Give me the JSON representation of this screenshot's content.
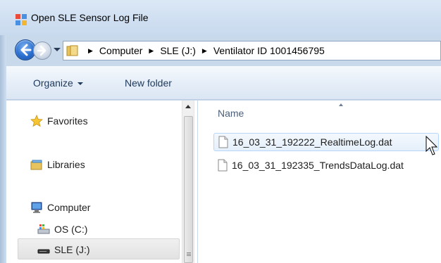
{
  "window": {
    "title": "Open SLE Sensor Log File"
  },
  "address_bar": {
    "crumbs": [
      "Computer",
      "SLE (J:)",
      "Ventilator ID 1001456795"
    ]
  },
  "toolbar": {
    "organize_label": "Organize",
    "new_folder_label": "New folder"
  },
  "navigation": {
    "items": [
      {
        "label": "Favorites",
        "icon": "star-icon"
      },
      {
        "label": "Libraries",
        "icon": "libraries-icon"
      },
      {
        "label": "Computer",
        "icon": "computer-icon"
      },
      {
        "label": "OS (C:)",
        "icon": "drive-os-icon"
      },
      {
        "label": "SLE (J:)",
        "icon": "removable-drive-icon",
        "selected": true
      }
    ]
  },
  "file_list": {
    "column_header": "Name",
    "files": [
      {
        "name": "16_03_31_192222_RealtimeLog.dat",
        "hovered": true
      },
      {
        "name": "16_03_31_192335_TrendsDataLog.dat",
        "hovered": false
      }
    ]
  },
  "colors": {
    "toolbar_text": "#1e395b",
    "hover_border": "#b8d6fb",
    "back_button": "#2a6fd0"
  }
}
